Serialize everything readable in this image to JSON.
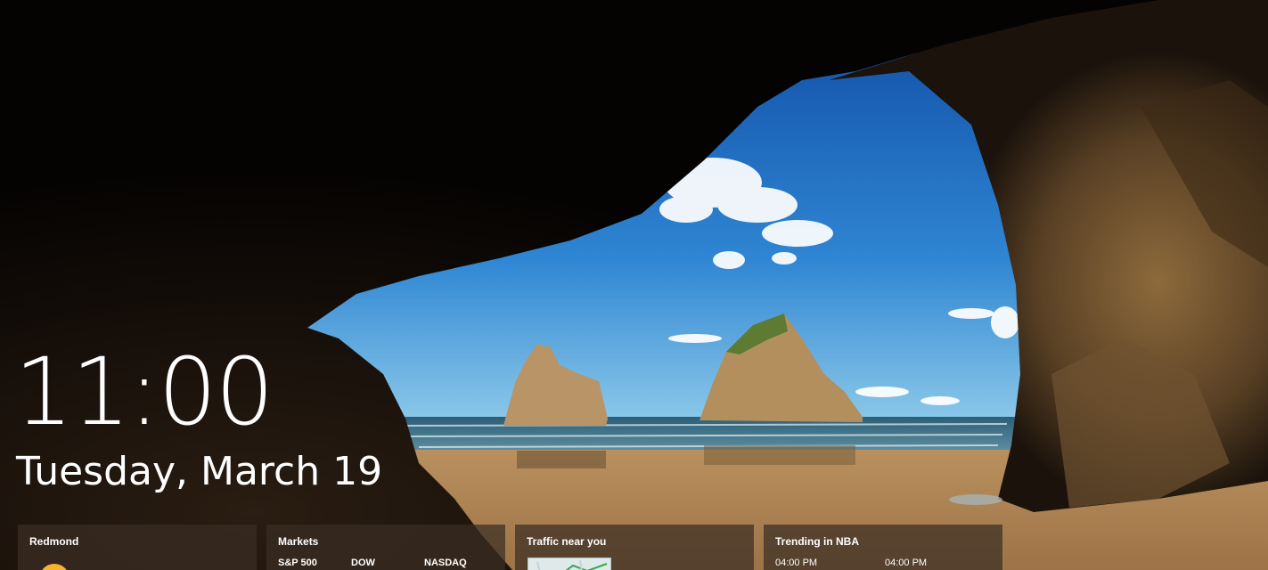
{
  "lock_screen": {
    "time": "11:00",
    "date": "Tuesday, March 19"
  },
  "widgets": {
    "weather": {
      "title": "Redmond"
    },
    "markets": {
      "title": "Markets",
      "columns": [
        "S&P 500",
        "DOW",
        "NASDAQ"
      ]
    },
    "traffic": {
      "title": "Traffic near you"
    },
    "trending": {
      "title": "Trending in NBA",
      "times": [
        "04:00 PM",
        "04:00 PM"
      ]
    }
  },
  "colors": {
    "sky_top": "#1a63b8",
    "sky_bottom": "#7fc3ea",
    "sand": "#b98a55",
    "sea": "#2f6f86",
    "rock": "#8a6a3c",
    "widget_bg": "#3a2e24"
  }
}
